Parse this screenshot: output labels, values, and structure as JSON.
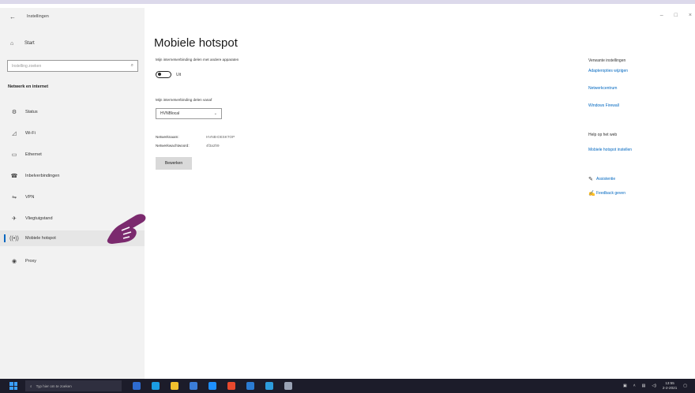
{
  "app": {
    "title": "Instellingen"
  },
  "window_controls": [
    "–",
    "□",
    "×"
  ],
  "sidebar": {
    "start_label": "Start",
    "search_placeholder": "Instelling zoeken",
    "section_title": "Netwerk en internet",
    "items": [
      {
        "label": "Status",
        "icon": "status-icon"
      },
      {
        "label": "Wi-Fi",
        "icon": "wifi-icon"
      },
      {
        "label": "Ethernet",
        "icon": "ethernet-icon"
      },
      {
        "label": "Inbelverbindingen",
        "icon": "dialup-icon"
      },
      {
        "label": "VPN",
        "icon": "vpn-icon"
      },
      {
        "label": "Vliegtuigstand",
        "icon": "airplane-icon"
      },
      {
        "label": "Mobiele hotspot",
        "icon": "hotspot-icon",
        "active": true
      },
      {
        "label": "Proxy",
        "icon": "globe-icon"
      }
    ]
  },
  "main": {
    "title": "Mobiele hotspot",
    "share_label": "Mijn internetverbinding delen met andere apparaten",
    "toggle": {
      "state": "Uit",
      "on": false
    },
    "share_from_label": "Mijn internetverbinding delen vanaf",
    "share_from_value": "HVNBlocal",
    "network_name_label": "Netwerknaam:",
    "network_name_value": "HVNB-DESKTOP",
    "network_password_label": "Netwerkwachtwoord:",
    "network_password_value": "4f3a2h9",
    "edit_button": "Bewerken"
  },
  "related": {
    "heading": "Verwante instellingen",
    "links": [
      "Adapteropties wijzigen",
      "Netwerkcentrum",
      "Windows Firewall"
    ]
  },
  "web_help": {
    "heading": "Help op het web",
    "link": "Mobiele hotspot instellen"
  },
  "help": {
    "get_help": "Assistentie",
    "feedback": "Feedback geven"
  },
  "taskbar": {
    "search_placeholder": "Typ hier om te zoeken",
    "time": "13:55",
    "date": "2-2-2021"
  },
  "colors": {
    "accent": "#0067c0",
    "pointer": "#7b2a6e"
  }
}
